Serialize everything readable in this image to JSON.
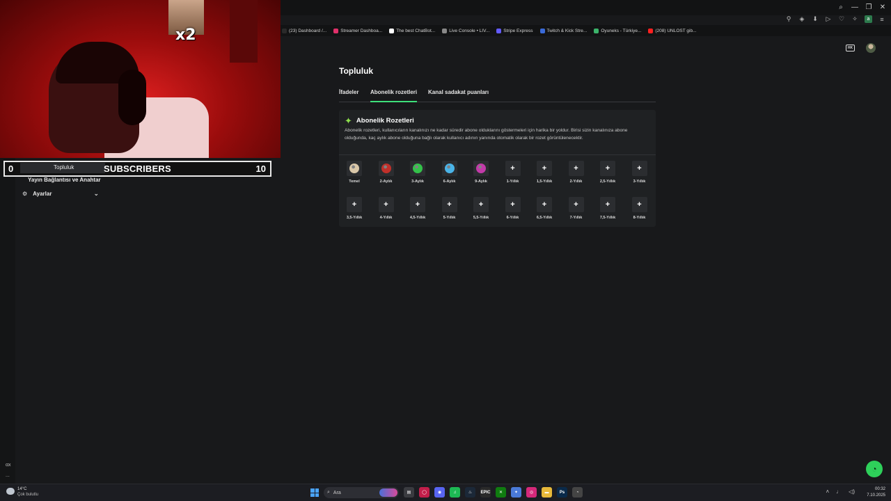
{
  "stream_overlay": {
    "emote_multiplier": "x2",
    "subscribers_label": "SUBSCRIBERS",
    "subscribers_current": "0",
    "subscribers_goal": "10"
  },
  "browser": {
    "bookmarks": [
      {
        "label": "(23) Dashboard /...",
        "color": "#2a2a2a"
      },
      {
        "label": "Streamer Dashboa...",
        "color": "#e0306a"
      },
      {
        "label": "The best ChatBot...",
        "color": "#ffffff"
      },
      {
        "label": "Live Console • LIV...",
        "color": "#888888"
      },
      {
        "label": "Stripe Express",
        "color": "#635bff"
      },
      {
        "label": "Twitch & Kick Stre...",
        "color": "#3a6ad8"
      },
      {
        "label": "Oyuneks - Türkiye...",
        "color": "#3bb36a"
      },
      {
        "label": "(208) UNLOST gib...",
        "color": "#ff2020"
      }
    ]
  },
  "sidebar": {
    "community_label": "Topluluk",
    "stream_key_label": "Yayın Bağlantısı ve Anahtar",
    "settings_label": "Ayarlar",
    "bottom_label": "αx",
    "more_label": "..."
  },
  "main": {
    "title": "Topluluk",
    "tabs": [
      {
        "label": "İfadeler",
        "active": false
      },
      {
        "label": "Abonelik rozetleri",
        "active": true
      },
      {
        "label": "Kanal sadakat puanları",
        "active": false
      }
    ],
    "card": {
      "title": "Abonelik Rozetleri",
      "description": "Abonelik rozetleri, kullanıcıların kanalınızı ne kadar süredir abone olduklarını göstermeleri için harika bir yoldur. Birisi sizin kanalınıza abone olduğunda, kaç aylık abone olduğuna bağlı olarak kullanıcı adının yanında otomatik olarak bir rozet görüntülenecektir."
    },
    "badges": [
      {
        "label": "Temel",
        "kind": "image",
        "color": "#d9c7a8"
      },
      {
        "label": "2-Aylık",
        "kind": "image",
        "color": "#c0302a"
      },
      {
        "label": "3-Aylık",
        "kind": "image",
        "color": "#34c24a"
      },
      {
        "label": "6-Aylık",
        "kind": "image",
        "color": "#4ab4e8"
      },
      {
        "label": "9-Aylık",
        "kind": "image",
        "color": "#c23aa8"
      },
      {
        "label": "1-Yıllık",
        "kind": "add"
      },
      {
        "label": "1,5-Yıllık",
        "kind": "add"
      },
      {
        "label": "2-Yıllık",
        "kind": "add"
      },
      {
        "label": "2,5-Yıllık",
        "kind": "add"
      },
      {
        "label": "3-Yıllık",
        "kind": "add"
      },
      {
        "label": "3,5-Yıllık",
        "kind": "add"
      },
      {
        "label": "4-Yıllık",
        "kind": "add"
      },
      {
        "label": "4,5-Yıllık",
        "kind": "add"
      },
      {
        "label": "5-Yıllık",
        "kind": "add"
      },
      {
        "label": "5,5-Yıllık",
        "kind": "add"
      },
      {
        "label": "6-Yıllık",
        "kind": "add"
      },
      {
        "label": "6,5-Yıllık",
        "kind": "add"
      },
      {
        "label": "7-Yıllık",
        "kind": "add"
      },
      {
        "label": "7,5-Yıllık",
        "kind": "add"
      },
      {
        "label": "8-Yıllık",
        "kind": "add"
      }
    ],
    "add_glyph": "+",
    "accent_color": "#3ee07a"
  },
  "taskbar": {
    "weather_temp": "14°C",
    "weather_desc": "Çok bulutlu",
    "search_placeholder": "Ara",
    "time": "00:32",
    "date": "7.10.2025",
    "apps": [
      {
        "icon": "file-explorer-icon",
        "glyph": "▤",
        "color": "#3a3b40"
      },
      {
        "icon": "opera-gx-icon",
        "glyph": "◯",
        "color": "#c21e4a"
      },
      {
        "icon": "discord-icon",
        "glyph": "◉",
        "color": "#5865f2"
      },
      {
        "icon": "spotify-icon",
        "glyph": "♫",
        "color": "#1db954"
      },
      {
        "icon": "steam-icon",
        "glyph": "♨",
        "color": "#1b2838"
      },
      {
        "icon": "epic-games-icon",
        "glyph": "EPIC",
        "color": "#2a2a2a"
      },
      {
        "icon": "xbox-icon",
        "glyph": "✕",
        "color": "#107c10"
      },
      {
        "icon": "copilot-icon",
        "glyph": "✦",
        "color": "#4a7ad8"
      },
      {
        "icon": "instagram-icon",
        "glyph": "◎",
        "color": "#d6297a"
      },
      {
        "icon": "folder-icon",
        "glyph": "▬",
        "color": "#e8b93a"
      },
      {
        "icon": "photoshop-icon",
        "glyph": "Ps",
        "color": "#0a2a4a"
      },
      {
        "icon": "chrome-icon",
        "glyph": "◔",
        "color": "#444"
      }
    ]
  }
}
